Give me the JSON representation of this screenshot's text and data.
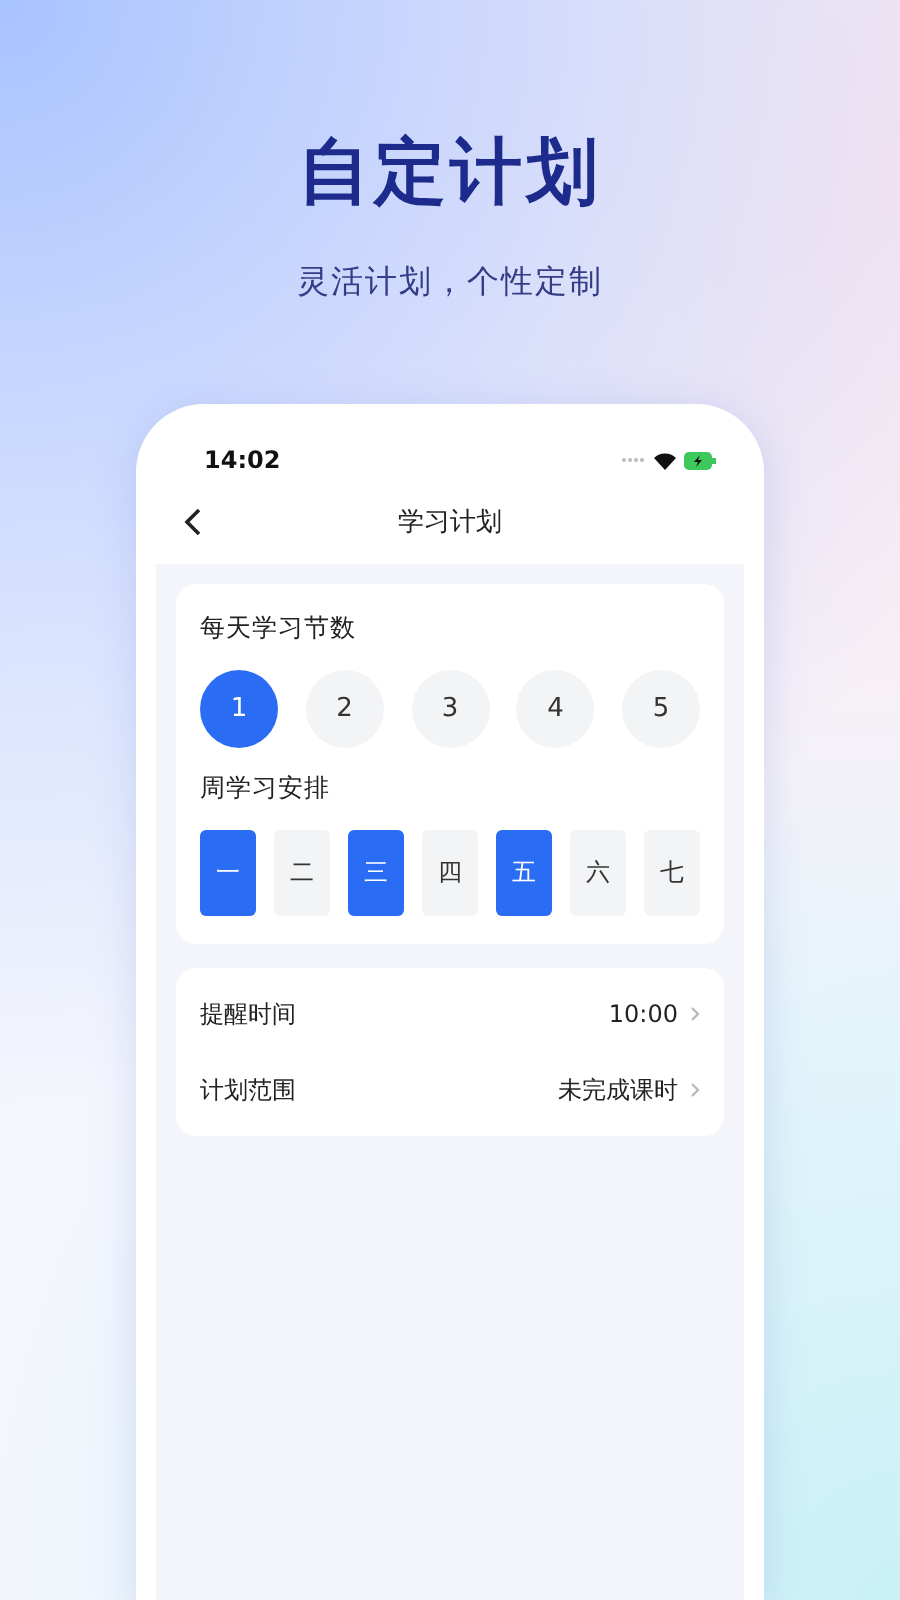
{
  "headline": "自定计划",
  "subtitle": "灵活计划，个性定制",
  "status_bar": {
    "time": "14:02"
  },
  "nav": {
    "title": "学习计划"
  },
  "daily_lessons": {
    "label": "每天学习节数",
    "options": [
      {
        "label": "1",
        "selected": true
      },
      {
        "label": "2",
        "selected": false
      },
      {
        "label": "3",
        "selected": false
      },
      {
        "label": "4",
        "selected": false
      },
      {
        "label": "5",
        "selected": false
      }
    ]
  },
  "weekly_schedule": {
    "label": "周学习安排",
    "days": [
      {
        "label": "一",
        "selected": true
      },
      {
        "label": "二",
        "selected": false
      },
      {
        "label": "三",
        "selected": true
      },
      {
        "label": "四",
        "selected": false
      },
      {
        "label": "五",
        "selected": true
      },
      {
        "label": "六",
        "selected": false
      },
      {
        "label": "七",
        "selected": false
      }
    ]
  },
  "settings": [
    {
      "label": "提醒时间",
      "value": "10:00"
    },
    {
      "label": "计划范围",
      "value": "未完成课时"
    }
  ]
}
